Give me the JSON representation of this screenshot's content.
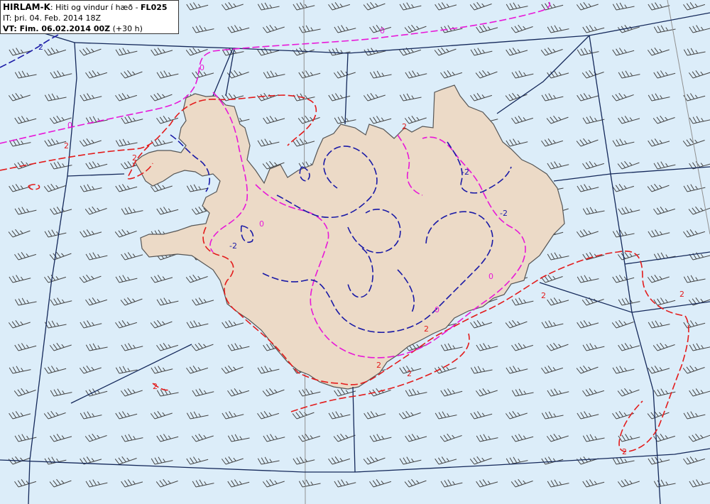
{
  "header": {
    "model": "HIRLAM-K",
    "separator": ": ",
    "description": "Hiti og vindur í hæð - ",
    "level": "FL025",
    "issue_time": "IT: þri. 04. Feb. 2014 18Z",
    "valid_label": "VT: Fim. 06.02.2014 00Z",
    "valid_offset": " (+30 h)"
  },
  "map": {
    "colors": {
      "sea": "#dcedf9",
      "land": "#ecdac7",
      "coast": "#555555",
      "fir_boundary": "#14285a",
      "meridian": "#909090",
      "barb": "#444444",
      "contour_neg2": "#1a1aa6",
      "contour_0": "#e817d8",
      "contour_pos2": "#e31b1b"
    },
    "contour_labels": [
      {
        "text": "-2",
        "color": "#1a1aa6"
      },
      {
        "text": "0",
        "color": "#e817d8"
      },
      {
        "text": "0",
        "color": "#e817d8"
      },
      {
        "text": "0",
        "color": "#e817d8"
      },
      {
        "text": "2",
        "color": "#e31b1b"
      },
      {
        "text": "2",
        "color": "#e31b1b"
      },
      {
        "text": "2",
        "color": "#e31b1b"
      },
      {
        "text": "2",
        "color": "#e31b1b"
      },
      {
        "text": "2",
        "color": "#e31b1b"
      },
      {
        "text": "2",
        "color": "#e31b1b"
      },
      {
        "text": "2",
        "color": "#e31b1b"
      },
      {
        "text": "-2",
        "color": "#1a1aa6"
      },
      {
        "text": "-2",
        "color": "#1a1aa6"
      },
      {
        "text": "-2",
        "color": "#1a1aa6"
      },
      {
        "text": "0",
        "color": "#e817d8"
      },
      {
        "text": "0",
        "color": "#e817d8"
      },
      {
        "text": "0",
        "color": "#e817d8"
      },
      {
        "text": "2",
        "color": "#e31b1b"
      },
      {
        "text": "2",
        "color": "#e31b1b"
      },
      {
        "text": "2",
        "color": "#e31b1b"
      }
    ],
    "wind_barbs": {
      "description_icon": "wind-barb-icon",
      "prevailing_direction_deg": 255,
      "speed_kt": 35
    }
  }
}
